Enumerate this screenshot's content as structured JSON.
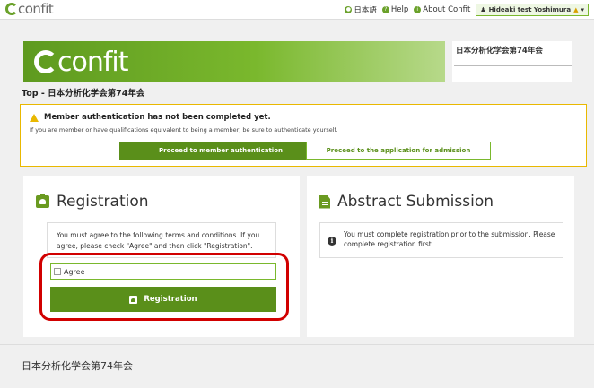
{
  "topbar": {
    "logo": "confit",
    "nav": [
      {
        "label": "日本語",
        "icon": "globe-icon"
      },
      {
        "label": "Help",
        "icon": "help-icon"
      },
      {
        "label": "About Confit",
        "icon": "info-icon"
      }
    ],
    "user": "Hideaki test Yoshimura"
  },
  "banner": {
    "logo": "confit",
    "conference": "日本分析化学会第74年会"
  },
  "breadcrumb": "Top - 日本分析化学会第74年会",
  "alert": {
    "title": "Member authentication has not been completed yet.",
    "message": "If you are member or have qualifications equivalent to being a member, be sure to authenticate yourself.",
    "auth_button": "Proceed to member authentication",
    "admission_button": "Proceed to the application for admission"
  },
  "registration": {
    "title": "Registration",
    "terms_text": "You must agree to the following terms and conditions. If you agree, please check \"Agree\" and then click \"Registration\".",
    "agree_label": "Agree",
    "button_label": "Registration"
  },
  "abstract": {
    "title": "Abstract Submission",
    "note": "You must complete registration prior to the submission. Please complete registration first."
  },
  "footer": "日本分析化学会第74年会",
  "colors": {
    "brand_green": "#5a8f1a",
    "accent_green": "#7ab82d",
    "warning": "#e9b800",
    "highlight_red": "#d10000"
  }
}
